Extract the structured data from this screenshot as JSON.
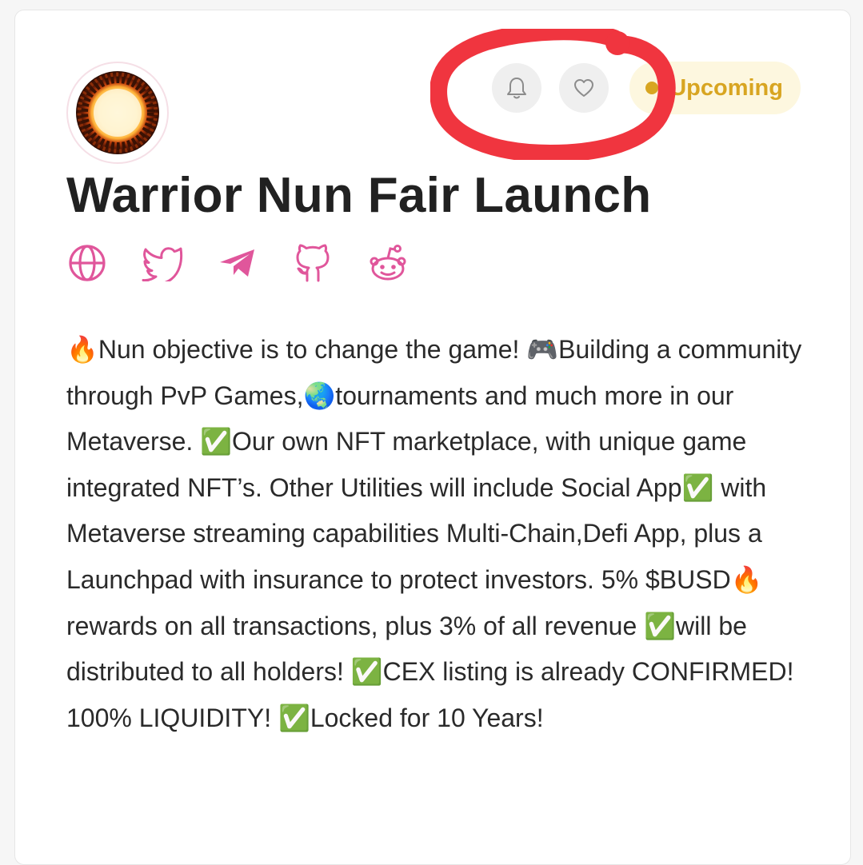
{
  "project": {
    "title": "Warrior Nun Fair Launch",
    "status": "Upcoming",
    "description": "🔥Nun objective is to change the game! 🎮Building a community through PvP Games,🌏tournaments and much more in our Metaverse. ✅Our own NFT marketplace, with unique game integrated NFT’s. Other Utilities will include Social App✅ with Metaverse streaming capabilities Multi-Chain,Defi App, plus a Launchpad with insurance to protect investors. 5% $BUSD🔥rewards on all transactions, plus 3% of all revenue ✅will be distributed to all holders! ✅CEX listing is already CONFIRMED! 100% LIQUIDITY! ✅Locked for 10 Years!"
  },
  "actions": [
    {
      "icon": "bell-icon"
    },
    {
      "icon": "heart-icon"
    }
  ],
  "socials": [
    {
      "icon": "globe-icon"
    },
    {
      "icon": "twitter-icon"
    },
    {
      "icon": "telegram-icon"
    },
    {
      "icon": "github-icon"
    },
    {
      "icon": "reddit-icon"
    }
  ],
  "colors": {
    "accent": "#e0569b",
    "status_text": "#d8a521",
    "status_bg": "#fdf7df",
    "annotation": "#f0353f"
  }
}
